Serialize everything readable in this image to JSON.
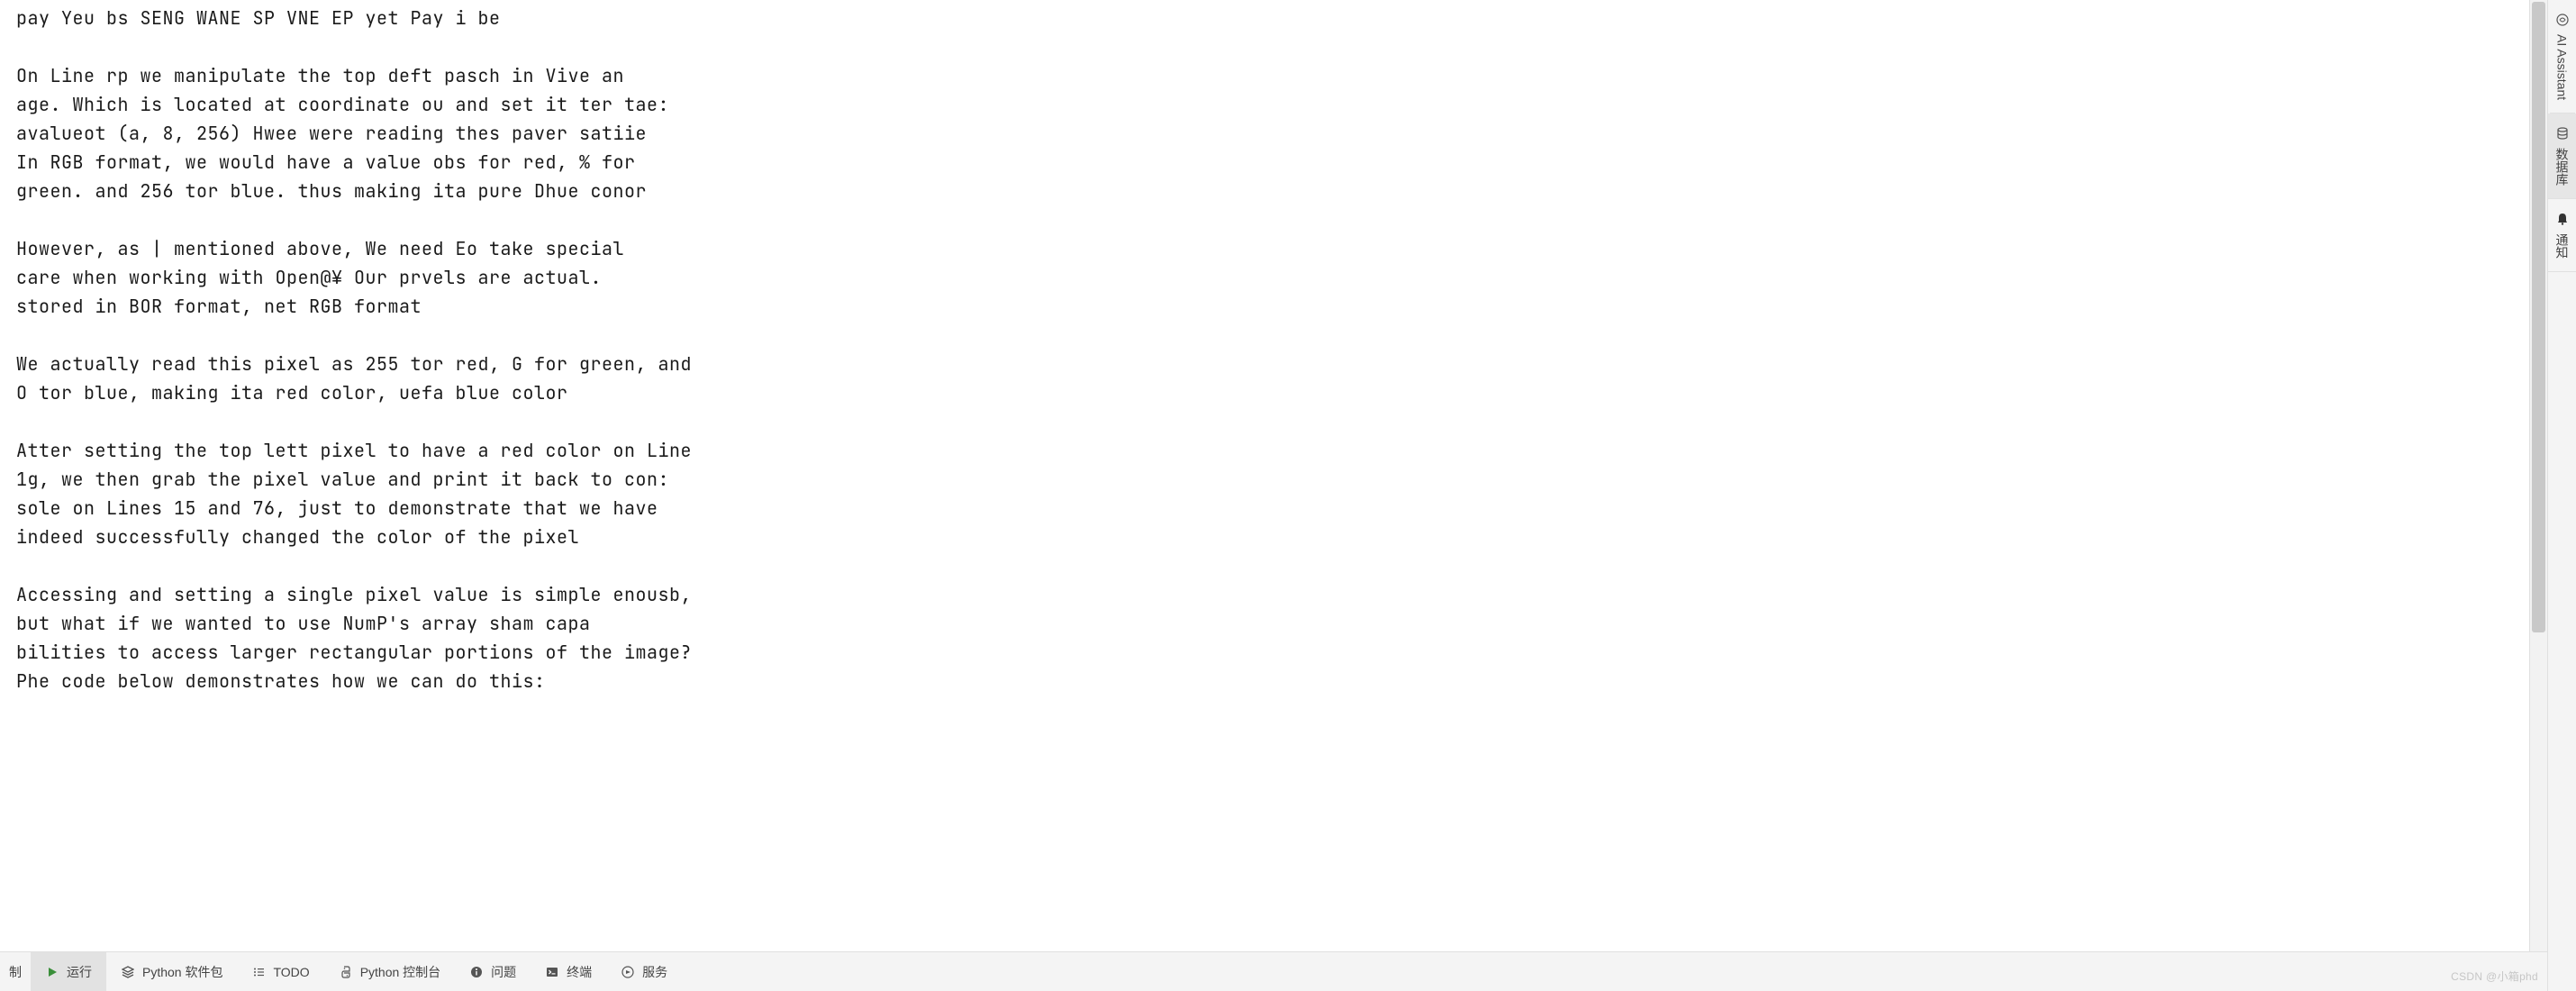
{
  "editor": {
    "lines": [
      "pay Yeu bs SENG WANE SP VNE EP yet Pay i be",
      "",
      "On Line rp we manipulate the top deft pasch in Vive an",
      "age. Which is located at coordinate ou and set it ter tae:",
      "avalueot (a, 8, 256) Hwee were reading thes paver satiie",
      "In RGB format, we would have a value obs for red, % for",
      "green. and 256 tor blue. thus making ita pure Dhue conor",
      "",
      "However, as | mentioned above, We need Eo take special",
      "care when working with Open@¥ Our prvels are actual.",
      "stored in BOR format, net RGB format",
      "",
      "We actually read this pixel as 255 tor red, G for green, and",
      "O tor blue, making ita red color, uefa blue color",
      "",
      "Atter setting the top lett pixel to have a red color on Line",
      "1g, we then grab the pixel value and print it back to con:",
      "sole on Lines 15 and 76, just to demonstrate that we have",
      "indeed successfully changed the color of the pixel",
      "",
      "Accessing and setting a single pixel value is simple enousb,",
      "but what if we wanted to use NumP's array sham capa",
      "bilities to access larger rectangular portions of the image?",
      "Phe code below demonstrates how we can do this:"
    ]
  },
  "rightRail": {
    "tabs": [
      {
        "id": "ai-assistant",
        "label": "AI Assistant",
        "icon": "ai"
      },
      {
        "id": "database",
        "label": "数据库",
        "icon": "db"
      },
      {
        "id": "notifications",
        "label": "通知",
        "icon": "bell"
      }
    ]
  },
  "bottomBar": {
    "leftTruncated": "制",
    "items": [
      {
        "id": "run",
        "label": "运行",
        "icon": "play",
        "active": true
      },
      {
        "id": "packages",
        "label": "Python 软件包",
        "icon": "layers"
      },
      {
        "id": "todo",
        "label": "TODO",
        "icon": "list"
      },
      {
        "id": "console",
        "label": "Python 控制台",
        "icon": "python"
      },
      {
        "id": "problems",
        "label": "问题",
        "icon": "info"
      },
      {
        "id": "terminal",
        "label": "终端",
        "icon": "terminal"
      },
      {
        "id": "services",
        "label": "服务",
        "icon": "services"
      }
    ]
  },
  "watermark": "CSDN @小箱phd"
}
